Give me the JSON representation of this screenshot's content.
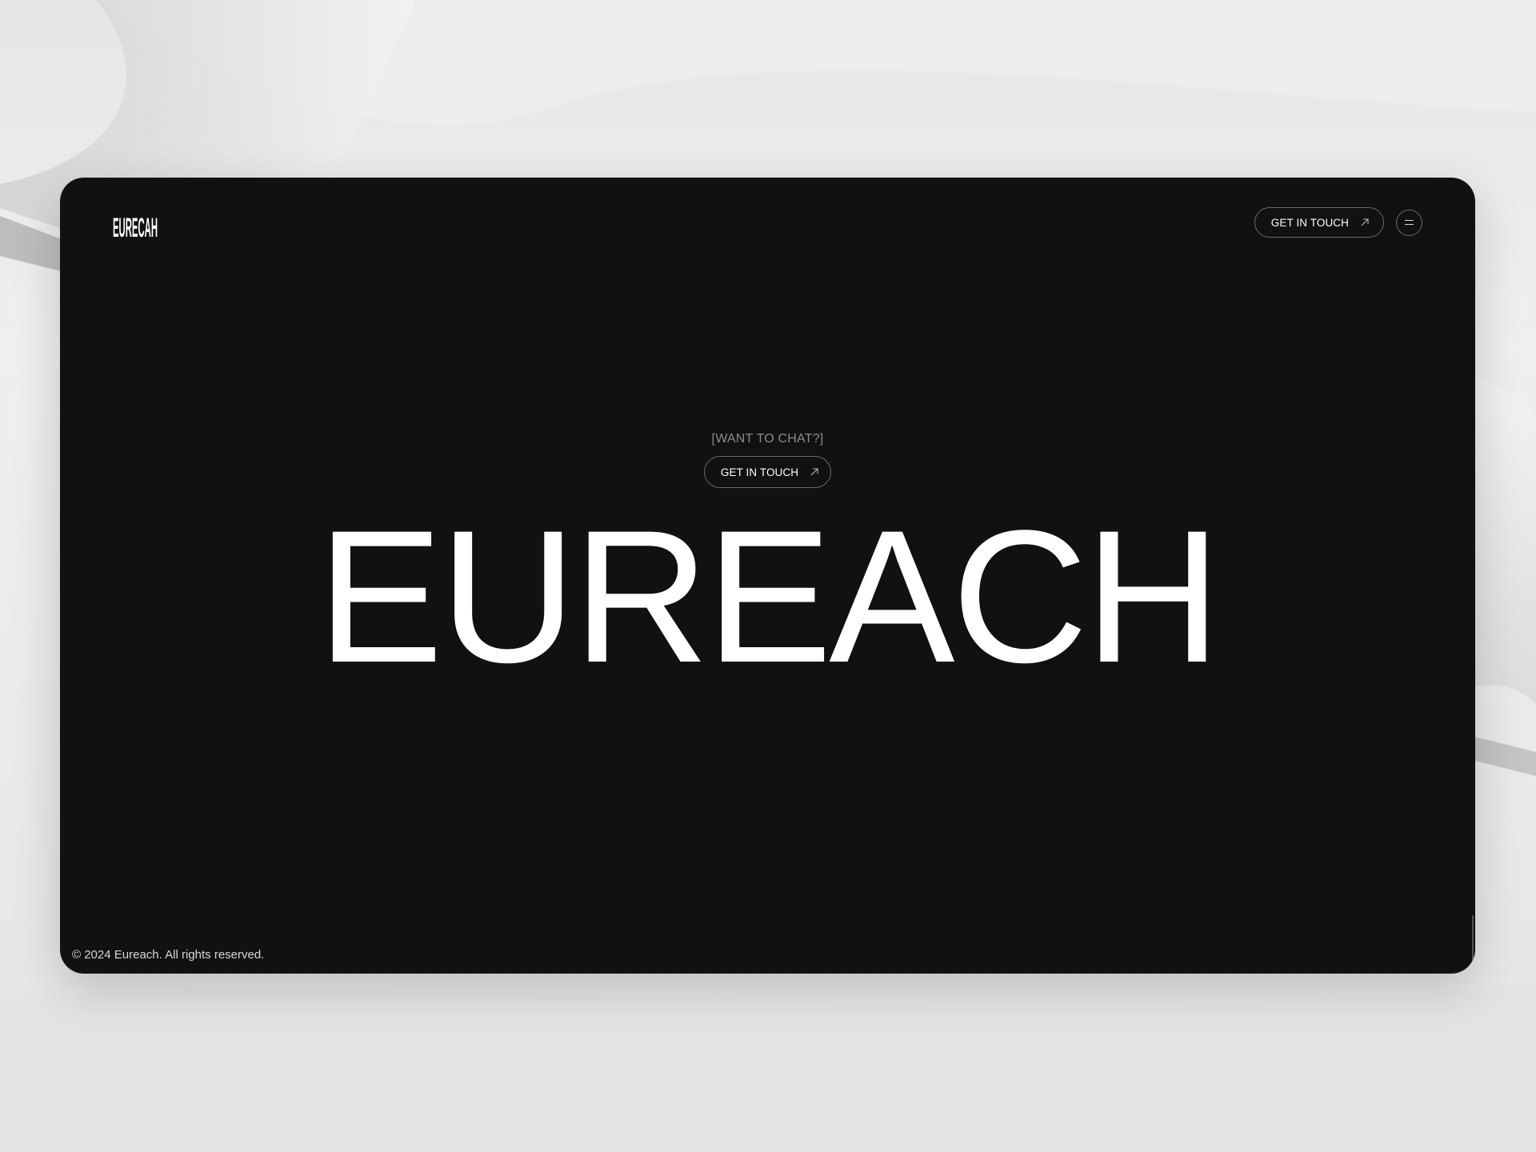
{
  "header": {
    "logo_text": "EURECAH",
    "cta_label": "GET IN TOUCH"
  },
  "hero": {
    "eyebrow": "[WANT TO CHAT?]",
    "cta_label": "GET IN TOUCH",
    "headline": "EUREACH"
  },
  "footer": {
    "copyright": "© 2024 Eureach. All rights reserved."
  },
  "icons": {
    "cta_arrow": "arrow-up-right-icon",
    "menu": "menu-icon"
  },
  "colors": {
    "window_bg": "#111111",
    "page_bg": "#e9e9e9",
    "text_primary": "#ffffff",
    "text_muted": "#8a8a8a",
    "border": "#6a6a6a"
  }
}
